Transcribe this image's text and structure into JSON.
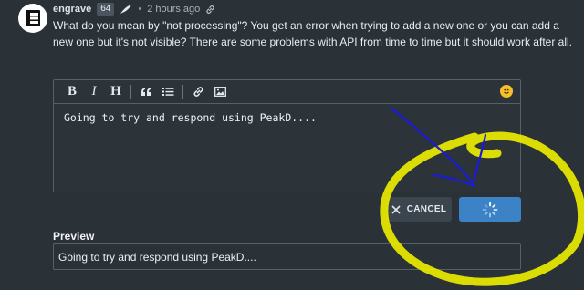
{
  "comment": {
    "author": "engrave",
    "reputation": "64",
    "separator": "•",
    "time": "2 hours ago",
    "text": "What do you mean by \"not processing\"? You get an error when trying to add a new one or you can add a new one but it's not visible? There are some problems with API from time to time but it should work after all."
  },
  "editor": {
    "toolbar": {
      "bold": "B",
      "italic": "I",
      "heading": "H"
    },
    "content": "Going to try and respond using PeakD...."
  },
  "actions": {
    "cancel_label": "CANCEL",
    "submit_state": "loading"
  },
  "preview": {
    "label": "Preview",
    "content": "Going to try and respond using PeakD...."
  },
  "colors": {
    "background": "#2a3137",
    "primary_button": "#3b82c6",
    "annotation_highlight": "#f0f000",
    "annotation_arrow": "#1a1ad8"
  }
}
